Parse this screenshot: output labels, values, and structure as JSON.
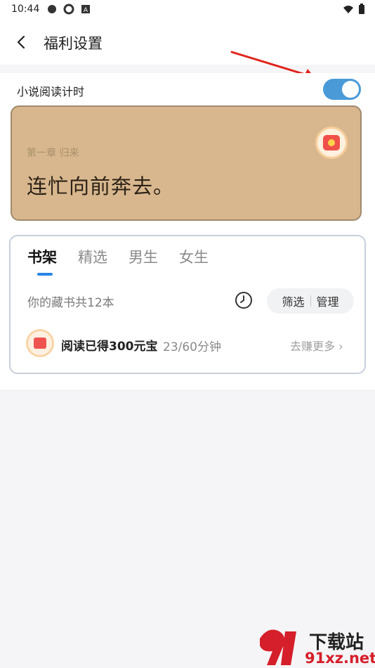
{
  "status": {
    "time": "10:44"
  },
  "header": {
    "title": "福利设置"
  },
  "reading_timer": {
    "label": "小说阅读计时",
    "enabled": true,
    "accent": "#4a9ad8"
  },
  "book_preview": {
    "chapter": "第一章 归来",
    "line": "连忙向前奔去。",
    "background": "#d8b78e"
  },
  "shelf": {
    "tabs": [
      "书架",
      "精选",
      "男生",
      "女生"
    ],
    "active_tab": 0,
    "count_text": "你的藏书共12本",
    "filter_label": "筛选",
    "manage_label": "管理",
    "reward_text": "阅读已得300元宝",
    "progress_text": "23/60分钟",
    "earn_more": "去赚更多 ›"
  },
  "watermark": {
    "text": "下载站",
    "url": "91xz.net"
  }
}
